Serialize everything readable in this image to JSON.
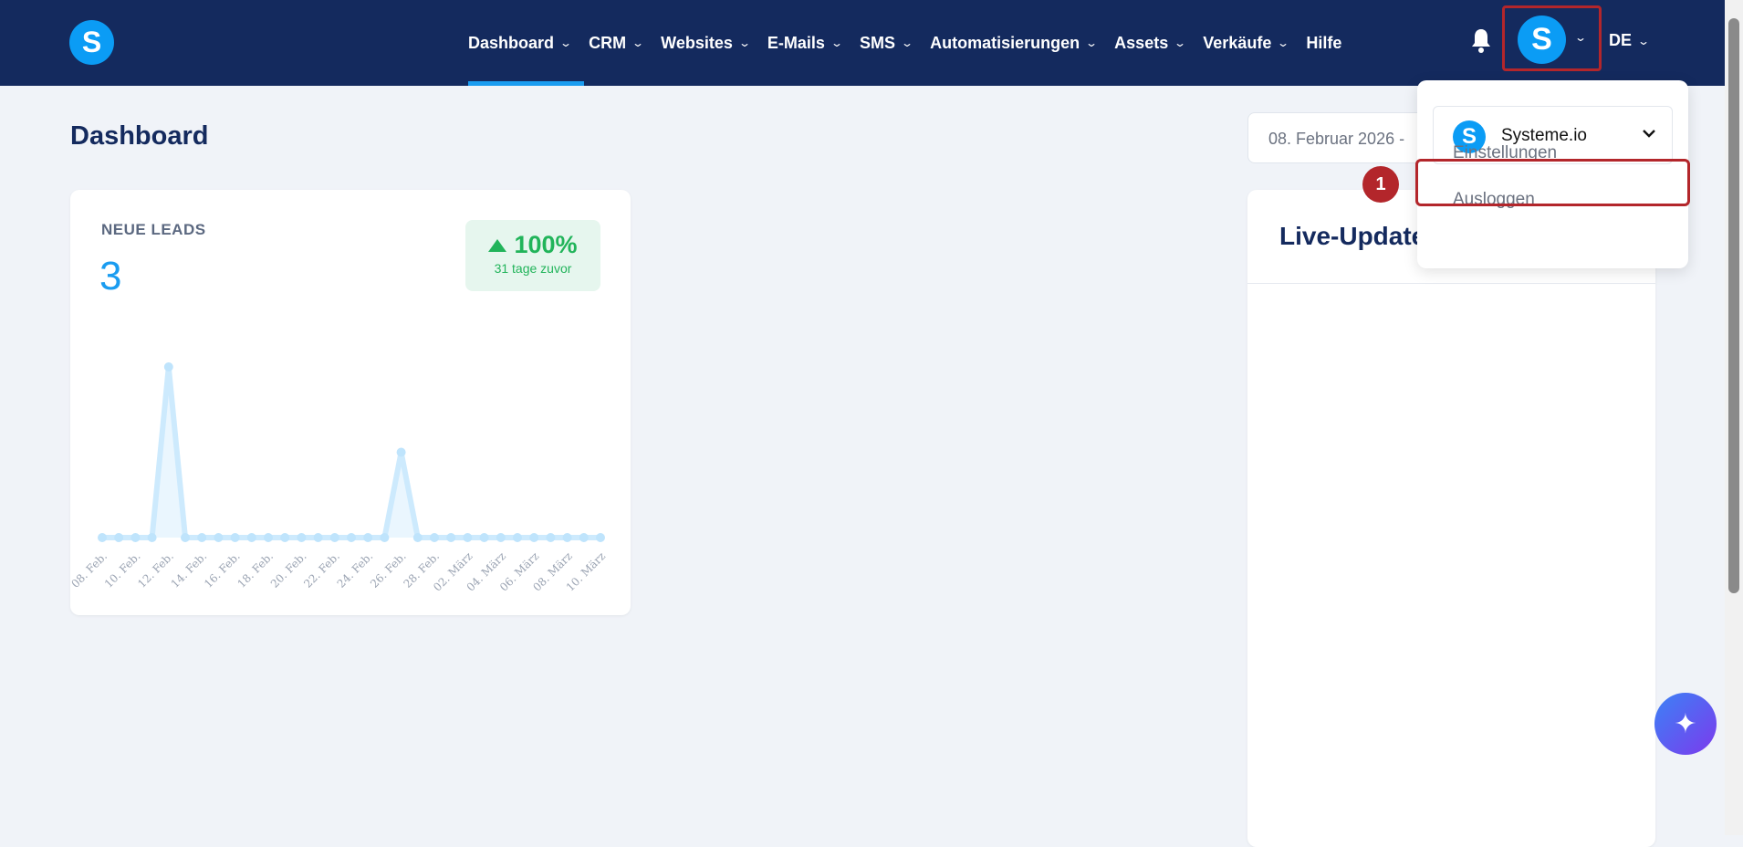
{
  "nav": {
    "logo": "S",
    "items": [
      {
        "label": "Dashboard",
        "dropdown": true
      },
      {
        "label": "CRM",
        "dropdown": true
      },
      {
        "label": "Websites",
        "dropdown": true
      },
      {
        "label": "E-Mails",
        "dropdown": true
      },
      {
        "label": "SMS",
        "dropdown": true
      },
      {
        "label": "Automatisierungen",
        "dropdown": true
      },
      {
        "label": "Assets",
        "dropdown": true
      },
      {
        "label": "Verkäufe",
        "dropdown": true
      },
      {
        "label": "Hilfe",
        "dropdown": false
      }
    ],
    "avatar": "S",
    "language": "DE",
    "chevron": "⌄"
  },
  "page": {
    "title": "Dashboard",
    "date_range": "08. Februar 2026 - "
  },
  "leads_card": {
    "label": "NEUE LEADS",
    "value": "3",
    "change": "100%",
    "change_sub": "31 tage zuvor",
    "color": "#1a9cf0",
    "positive_color": "#21b45a"
  },
  "live_updates": {
    "title": "Live-Updates"
  },
  "account_menu": {
    "account": "Systeme.io",
    "account_logo": "S",
    "items": [
      "Einstellungen",
      "Ausloggen"
    ]
  },
  "annotation": {
    "step": "1"
  },
  "chart_data": {
    "type": "line",
    "x": [
      "08. Feb.",
      "09. Feb.",
      "10. Feb.",
      "11. Feb.",
      "12. Feb.",
      "13. Feb.",
      "14. Feb.",
      "15. Feb.",
      "16. Feb.",
      "17. Feb.",
      "18. Feb.",
      "19. Feb.",
      "20. Feb.",
      "21. Feb.",
      "22. Feb.",
      "23. Feb.",
      "24. Feb.",
      "25. Feb.",
      "26. Feb.",
      "27. Feb.",
      "28. Feb.",
      "01. März",
      "02. März",
      "03. März",
      "04. März",
      "05. März",
      "06. März",
      "07. März",
      "08. März",
      "09. März",
      "10. März"
    ],
    "values": [
      0,
      0,
      0,
      0,
      2,
      0,
      0,
      0,
      0,
      0,
      0,
      0,
      0,
      0,
      0,
      0,
      0,
      0,
      1,
      0,
      0,
      0,
      0,
      0,
      0,
      0,
      0,
      0,
      0,
      0,
      0
    ],
    "tick_labels": [
      "08. Feb.",
      "10. Feb.",
      "12. Feb.",
      "14. Feb.",
      "16. Feb.",
      "18. Feb.",
      "20. Feb.",
      "22. Feb.",
      "24. Feb.",
      "26. Feb.",
      "28. Feb.",
      "02. März",
      "04. März",
      "06. März",
      "08. März",
      "10. März"
    ],
    "ylim": [
      0,
      2
    ],
    "grid": false
  }
}
